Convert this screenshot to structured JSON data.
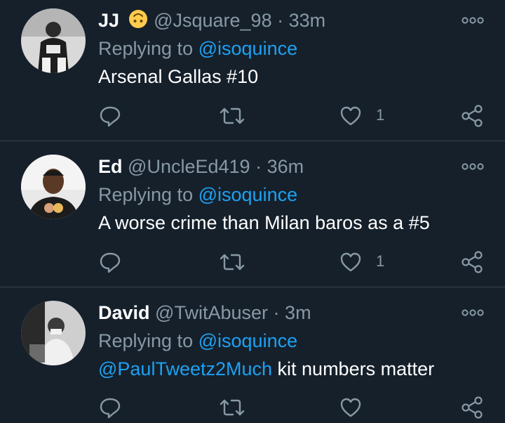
{
  "tweets": [
    {
      "name": "JJ",
      "handle": "@Jsquare_98",
      "time": "33m",
      "replying_label": "Replying to",
      "replying_to": "@isoquince",
      "text": "Arsenal Gallas #10",
      "text_mention": "",
      "likes": "1",
      "name_emoji": "upside-down-face-emoji"
    },
    {
      "name": "Ed",
      "handle": "@UncleEd419",
      "time": "36m",
      "replying_label": "Replying to",
      "replying_to": "@isoquince",
      "text": "A worse crime than Milan baros as a #5",
      "text_mention": "",
      "likes": "1"
    },
    {
      "name": "David",
      "handle": "@TwitAbuser",
      "time": "3m",
      "replying_label": "Replying to",
      "replying_to": "@isoquince",
      "text": " kit numbers matter",
      "text_mention": "@PaulTweetz2Much",
      "likes": ""
    }
  ],
  "separator": "·",
  "colors": {
    "background": "#15202b",
    "text": "#ffffff",
    "secondary": "#8899a6",
    "accent": "#1da1f2",
    "divider": "#38444d"
  },
  "icons": [
    "reply-icon",
    "retweet-icon",
    "like-icon",
    "share-icon",
    "more-options-icon"
  ]
}
